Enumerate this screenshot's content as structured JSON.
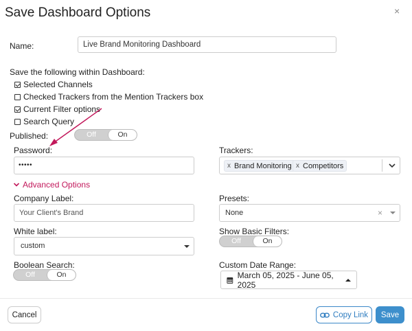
{
  "dialog": {
    "title": "Save Dashboard Options",
    "close": "×"
  },
  "name": {
    "label": "Name:",
    "value": "Live Brand Monitoring Dashboard"
  },
  "save_within": {
    "label": "Save the following within Dashboard:",
    "options": [
      {
        "label": "Selected Channels",
        "checked": true
      },
      {
        "label": "Checked Trackers from the Mention Trackers box",
        "checked": false
      },
      {
        "label": "Current Filter options",
        "checked": true
      },
      {
        "label": "Search Query",
        "checked": false
      }
    ]
  },
  "published": {
    "label": "Published:",
    "off": "Off",
    "on": "On",
    "value": "On"
  },
  "password": {
    "label": "Password:",
    "value": "•••••"
  },
  "trackers": {
    "label": "Trackers:",
    "chips": [
      {
        "remove": "x",
        "label": "Brand Monitoring"
      },
      {
        "remove": "x",
        "label": "Competitors"
      }
    ]
  },
  "advanced": {
    "label": "Advanced Options"
  },
  "company_label": {
    "label": "Company Label:",
    "placeholder": "Your Client's Brand"
  },
  "presets": {
    "label": "Presets:",
    "value": "None",
    "clear": "×"
  },
  "white_label": {
    "label": "White label:",
    "value": "custom"
  },
  "show_basic_filters": {
    "label": "Show Basic Filters:",
    "off": "Off",
    "on": "On",
    "value": "On"
  },
  "boolean_search": {
    "label": "Boolean Search:",
    "off": "Off",
    "on": "On",
    "value": "On"
  },
  "custom_date_range": {
    "label": "Custom Date Range:",
    "value": "March 05, 2025 - June 05, 2025"
  },
  "footer": {
    "cancel": "Cancel",
    "copy_link": "Copy Link",
    "save": "Save"
  },
  "colors": {
    "accent_pink": "#c2185b",
    "primary_blue": "#3d8fcc",
    "link_blue": "#2f7dc0"
  }
}
